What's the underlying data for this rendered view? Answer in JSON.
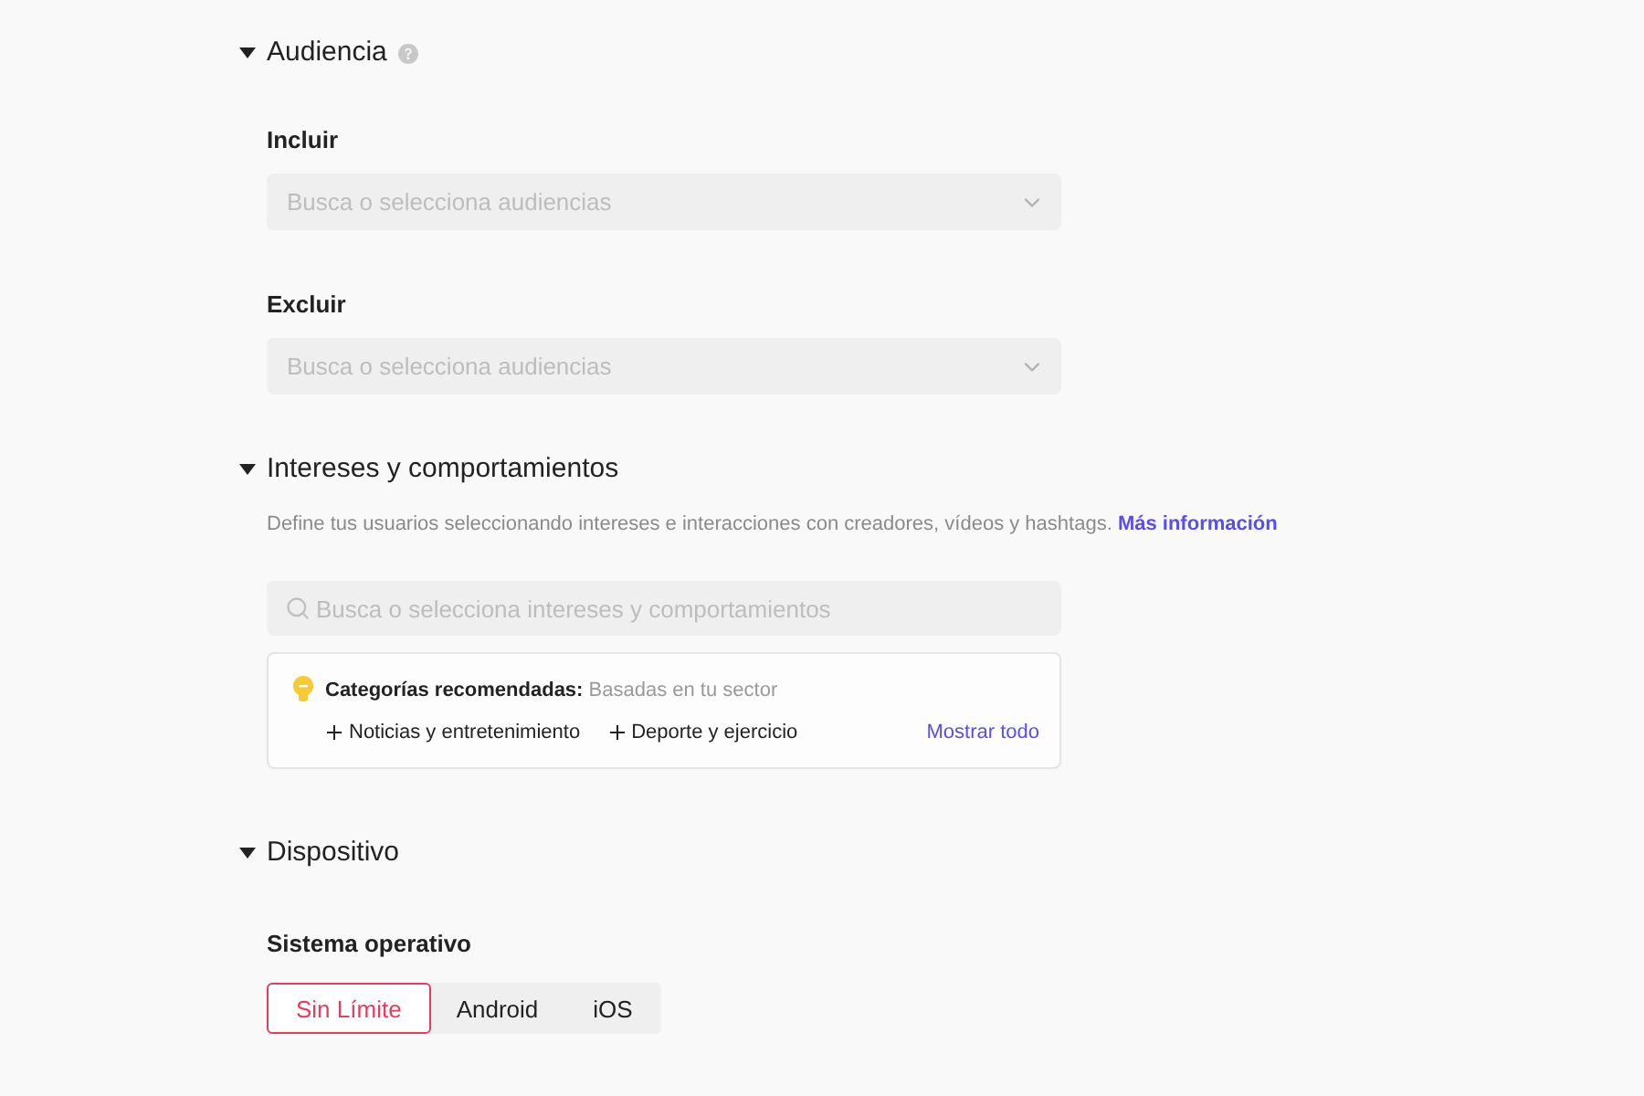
{
  "sections": [
    {
      "kind": "audience",
      "title": "Audiencia",
      "expanded": true,
      "help": true,
      "fields": [
        {
          "label": "Incluir",
          "placeholder": "Busca o selecciona audiencias"
        },
        {
          "label": "Excluir",
          "placeholder": "Busca o selecciona audiencias"
        }
      ]
    },
    {
      "kind": "interests",
      "title": "Intereses y comportamientos",
      "expanded": true,
      "help": false,
      "description": "Define tus usuarios seleccionando intereses e interacciones con creadores, vídeos y hashtags.",
      "link": "Más información",
      "search": {
        "placeholder": "Busca o selecciona intereses y comportamientos"
      },
      "recommendations": {
        "title": "Categorías recomendadas:",
        "subtitle": "Basadas en tu sector",
        "items": [
          "Noticias y entretenimiento",
          "Deporte y ejercicio"
        ],
        "show_all": "Mostrar todo"
      }
    },
    {
      "kind": "device",
      "title": "Dispositivo",
      "expanded": true,
      "help": false,
      "field": {
        "label": "Sistema operativo",
        "options": [
          {
            "label": "Sin Límite",
            "selected": true
          },
          {
            "label": "Android",
            "selected": false
          },
          {
            "label": "iOS",
            "selected": false
          }
        ]
      }
    }
  ]
}
